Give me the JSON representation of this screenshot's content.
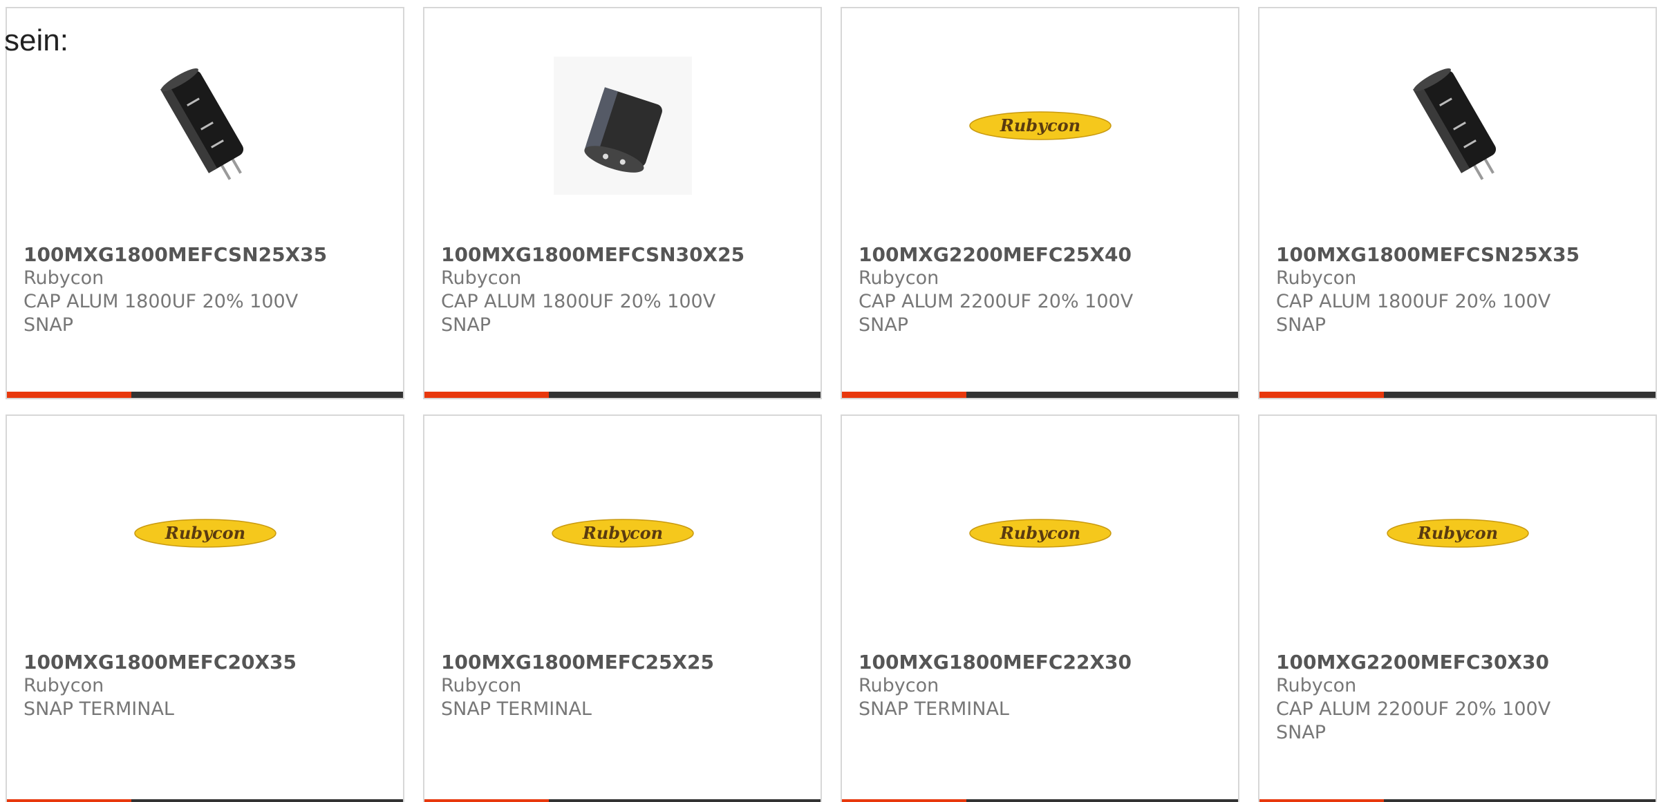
{
  "intro": {
    "text": "sein:"
  },
  "colors": {
    "accent": "#e8380d",
    "bar": "#333333",
    "logo_yellow": "#f5c81c",
    "logo_text": "#5a3b10"
  },
  "products": [
    {
      "part_number": "100MXG1800MEFCSN25X35",
      "manufacturer": "Rubycon",
      "description_lines": [
        "CAP ALUM 1800UF 20% 100V",
        "SNAP"
      ],
      "image": "capacitor-tall-photo"
    },
    {
      "part_number": "100MXG1800MEFCSN30X25",
      "manufacturer": "Rubycon",
      "description_lines": [
        "CAP ALUM 1800UF 20% 100V",
        "SNAP"
      ],
      "image": "capacitor-short-photo"
    },
    {
      "part_number": "100MXG2200MEFC25X40",
      "manufacturer": "Rubycon",
      "description_lines": [
        "CAP ALUM 2200UF 20% 100V",
        "SNAP"
      ],
      "image": "rubycon-logo",
      "logo_text": "Rubycon"
    },
    {
      "part_number": "100MXG1800MEFCSN25X35",
      "manufacturer": "Rubycon",
      "description_lines": [
        "CAP ALUM 1800UF 20% 100V",
        "SNAP"
      ],
      "image": "capacitor-tall-photo"
    },
    {
      "part_number": "100MXG1800MEFC20X35",
      "manufacturer": "Rubycon",
      "description_lines": [
        "SNAP TERMINAL"
      ],
      "image": "rubycon-logo",
      "logo_text": "Rubycon"
    },
    {
      "part_number": "100MXG1800MEFC25X25",
      "manufacturer": "Rubycon",
      "description_lines": [
        "SNAP TERMINAL"
      ],
      "image": "rubycon-logo",
      "logo_text": "Rubycon"
    },
    {
      "part_number": "100MXG1800MEFC22X30",
      "manufacturer": "Rubycon",
      "description_lines": [
        "SNAP TERMINAL"
      ],
      "image": "rubycon-logo",
      "logo_text": "Rubycon"
    },
    {
      "part_number": "100MXG2200MEFC30X30",
      "manufacturer": "Rubycon",
      "description_lines": [
        "CAP ALUM 2200UF 20% 100V",
        "SNAP"
      ],
      "image": "rubycon-logo",
      "logo_text": "Rubycon"
    }
  ]
}
